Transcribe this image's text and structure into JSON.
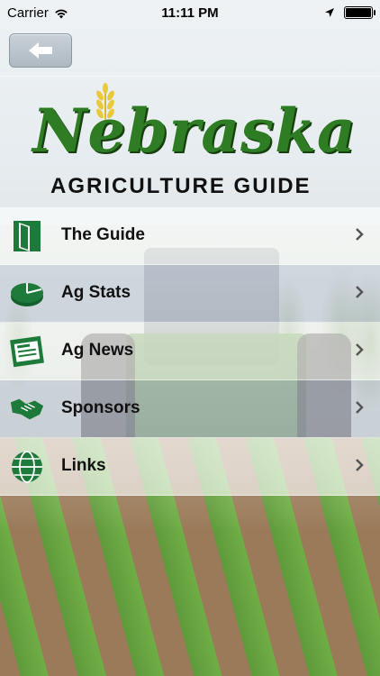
{
  "status_bar": {
    "carrier": "Carrier",
    "time": "11:11 PM"
  },
  "nav": {
    "back_icon": "back-arrow-icon"
  },
  "logo": {
    "title": "Nebraska",
    "subtitle": "AGRICULTURE GUIDE"
  },
  "menu": {
    "items": [
      {
        "label": "The Guide",
        "icon": "book-icon"
      },
      {
        "label": "Ag Stats",
        "icon": "pie-chart-icon"
      },
      {
        "label": "Ag News",
        "icon": "newspaper-icon"
      },
      {
        "label": "Sponsors",
        "icon": "handshake-icon"
      },
      {
        "label": "Links",
        "icon": "globe-icon"
      }
    ]
  },
  "colors": {
    "brand_green": "#2e7d24",
    "icon_green": "#1e7a3a"
  }
}
